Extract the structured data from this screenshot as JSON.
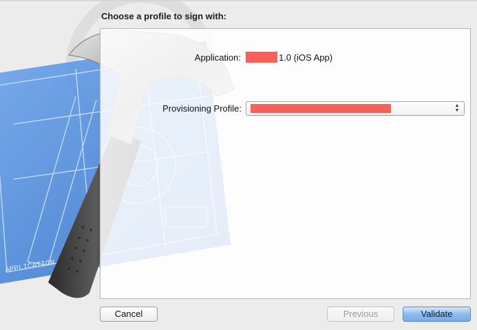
{
  "sheet": {
    "title": "Choose a profile to sign with:"
  },
  "application": {
    "label": "Application:",
    "version_text": "1.0 (iOS App)"
  },
  "provisioning": {
    "label": "Provisioning Profile:"
  },
  "buttons": {
    "cancel": "Cancel",
    "previous": "Previous",
    "validate": "Validate"
  },
  "colors": {
    "redaction": "#fb5f59",
    "accent_button": "#8ab8ee",
    "blueprint": "#4a86d8"
  },
  "artwork": {
    "blueprint_text": "APPLICATION.APP"
  },
  "icons": {
    "select_arrows": "updown-icon",
    "background_art": "xcode-hammer-blueprint"
  }
}
